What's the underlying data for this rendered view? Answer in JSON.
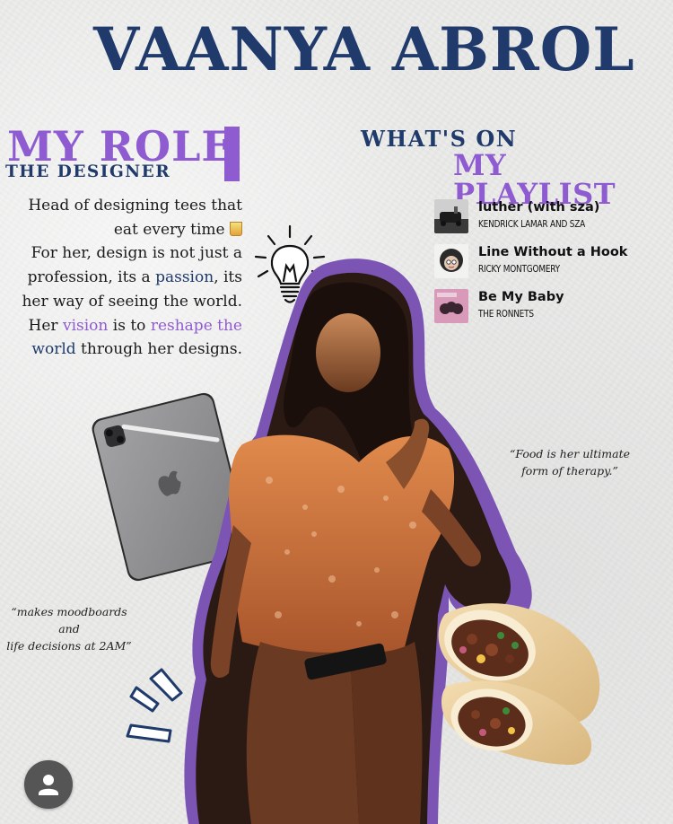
{
  "header": {
    "title": "VAANYA ABROL"
  },
  "role": {
    "title": "MY ROLE",
    "subtitle": "THE DESIGNER",
    "bio": {
      "line1": "Head of designing tees that",
      "line2": "eat every time",
      "line3": "For her, design is not just a",
      "line4_a": "profession, its a ",
      "line4_b": "passion",
      "line4_c": ", its",
      "line5": "her way of seeing the world.",
      "line6_a": "Her ",
      "line6_b": "vision",
      "line6_c": " is to ",
      "line6_d": "reshape the",
      "line7_a": "world",
      "line7_b": " through her designs."
    }
  },
  "playlist": {
    "heading_top": "WHAT'S ON",
    "heading_bottom": "MY PLAYLIST",
    "tracks": [
      {
        "title": "luther (with sza)",
        "artist": "KENDRICK LAMAR AND SZA"
      },
      {
        "title": "Line Without a Hook",
        "artist": "RICKY MONTGOMERY"
      },
      {
        "title": "Be My Baby",
        "artist": "THE RONNETS"
      }
    ]
  },
  "quotes": {
    "food_line1": "“Food is her ultimate",
    "food_line2": "form of therapy.”",
    "moodboard_line1": "“makes moodboards and",
    "moodboard_line2": "life decisions at 2AM”"
  },
  "colors": {
    "navy": "#1f3a6b",
    "purple": "#8f5bd0",
    "paper": "#ebebea"
  },
  "icons": [
    "lightbulb-icon",
    "sparkle-lines-icon",
    "user-avatar-icon"
  ]
}
